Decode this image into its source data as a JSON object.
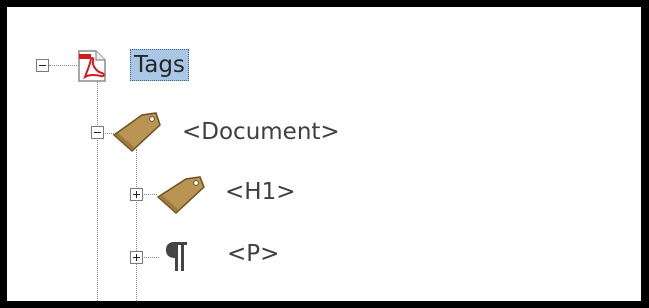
{
  "tree": {
    "root": {
      "label": "Tags",
      "icon": "pdf-document-icon",
      "expanded": true,
      "selected": true
    },
    "document": {
      "label": "<Document>",
      "icon": "tag-icon",
      "expanded": true
    },
    "h1": {
      "label": "<H1>",
      "icon": "tag-icon",
      "expanded": false
    },
    "p": {
      "label": "<P>",
      "icon": "paragraph-icon",
      "expanded": false
    }
  }
}
